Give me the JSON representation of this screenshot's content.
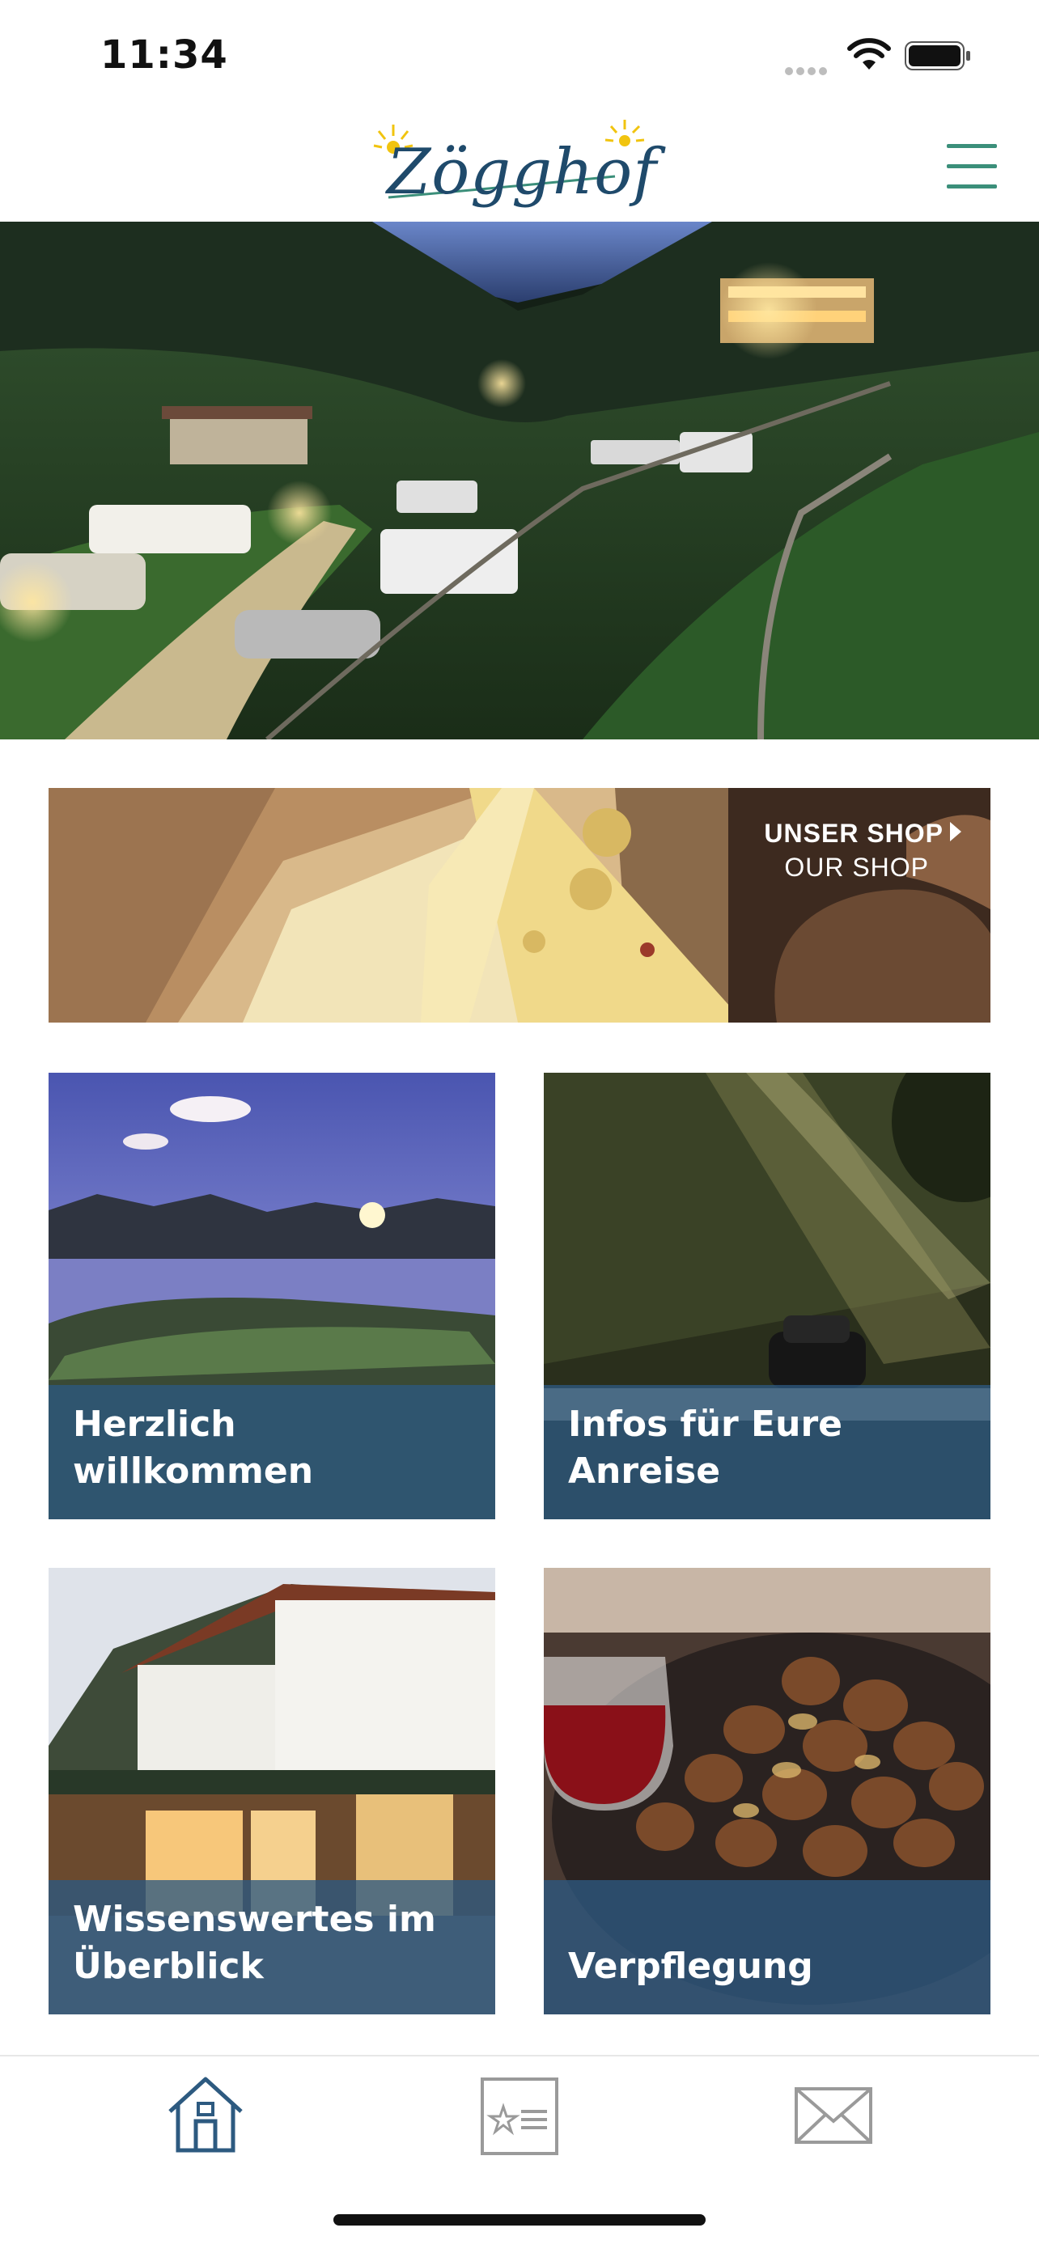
{
  "status_bar": {
    "time": "11:34"
  },
  "header": {
    "logo_text": "Zögghof",
    "menu_icon": "hamburger-icon",
    "accent_color": "#3b8f7a"
  },
  "shop_banner": {
    "title": "UNSER SHOP",
    "subtitle": "OUR SHOP"
  },
  "tiles": [
    {
      "label": "Herzlich\nwillkommen"
    },
    {
      "label": "Infos für Eure\nAnreise"
    },
    {
      "label": "Wissenswertes im\nÜberblick"
    },
    {
      "label": "Verpflegung"
    }
  ],
  "tabbar": {
    "items": [
      {
        "icon": "home-icon",
        "active": true
      },
      {
        "icon": "news-card-icon",
        "active": false
      },
      {
        "icon": "mail-icon",
        "active": false
      }
    ],
    "active_color": "#2d5a80",
    "inactive_color": "#9a9a9a"
  }
}
